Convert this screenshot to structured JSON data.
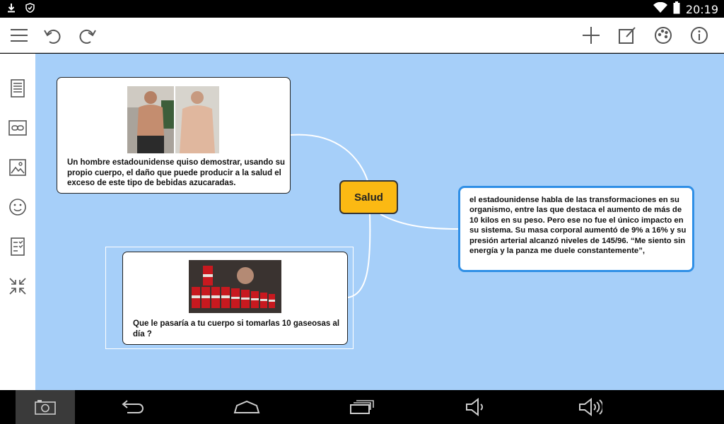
{
  "status_bar": {
    "time": "20:19",
    "left_icons": [
      "download-icon",
      "shield-icon"
    ],
    "right_icons": [
      "wifi-icon",
      "battery-icon"
    ]
  },
  "toolbar": {
    "left_icons": [
      "menu-icon",
      "undo-icon",
      "redo-icon"
    ],
    "right_icons": [
      "add-icon",
      "edit-icon",
      "palette-icon",
      "info-icon"
    ]
  },
  "side_tools": [
    "note-icon",
    "link-icon",
    "image-icon",
    "emoji-icon",
    "task-icon",
    "collapse-icon"
  ],
  "mindmap": {
    "center": {
      "label": "Salud"
    },
    "nodes": [
      {
        "id": "node-1",
        "text": "Un hombre estadounidense quiso demostrar, usando su propio cuerpo, el daño que puede producir a la salud el exceso de este tipo de bebidas azucaradas.",
        "images": [
          "before-photo",
          "after-photo"
        ]
      },
      {
        "id": "node-2",
        "text": "Que le pasaría a tu cuerpo si tomarlas 10 gaseosas al día ?",
        "images": [
          "soda-cans-photo"
        ]
      },
      {
        "id": "node-3",
        "text": "el estadounidense habla de las transformaciones en su organismo, entre las que destaca el aumento de más de 10 kilos en su peso. Pero ese no fue el único impacto en su sistema. Su masa corporal aumentó de 9% a 16% y su presión arterial alcanzó niveles de 145/96. “Me siento sin energía y la panza me duele constantemente”,"
      }
    ]
  },
  "colors": {
    "canvas": "#a6cff9",
    "center_node": "#fbb913",
    "selected_border": "#2f8fe6"
  },
  "nav_bar": [
    "screenshot-icon",
    "back-icon",
    "home-icon",
    "recent-apps-icon",
    "volume-down-icon",
    "volume-up-icon"
  ]
}
